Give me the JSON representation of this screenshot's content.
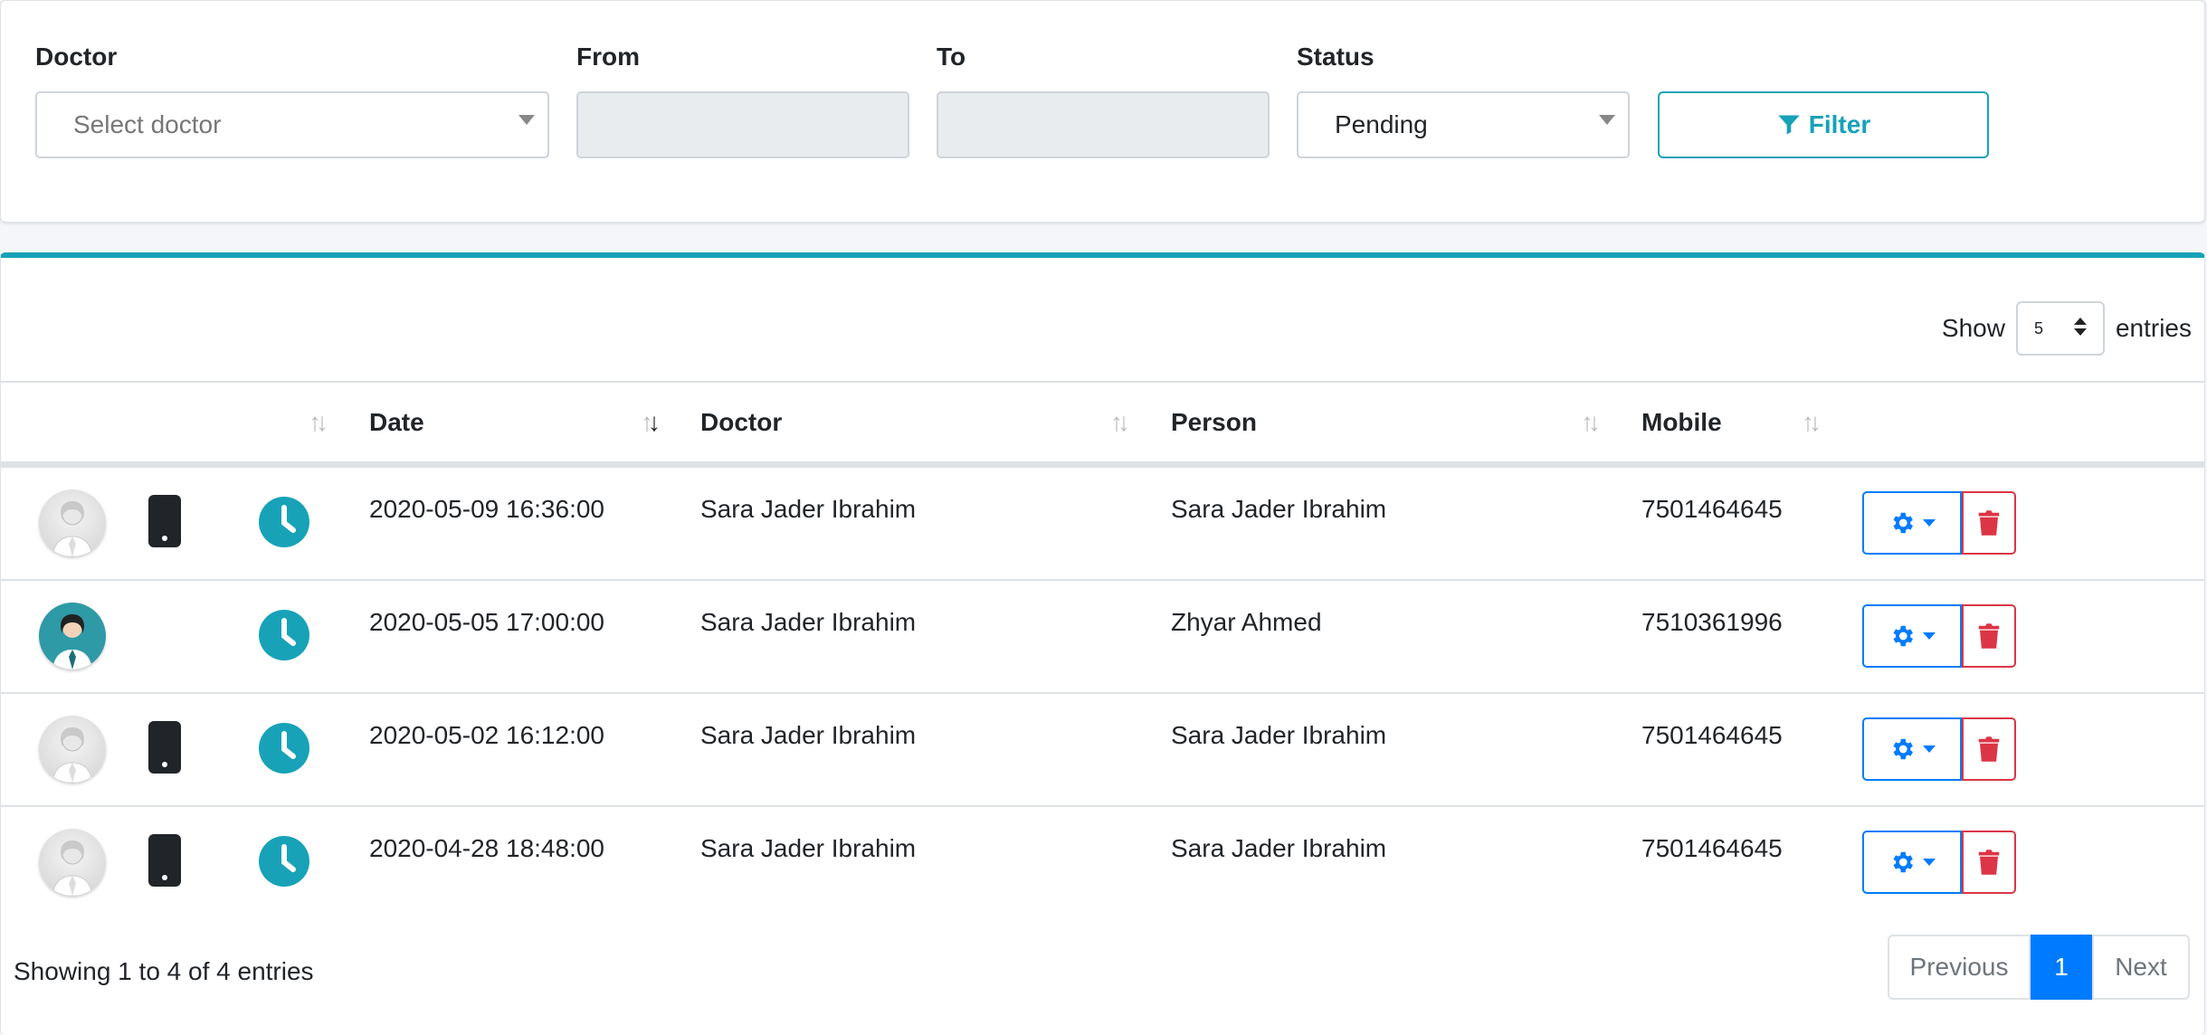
{
  "filters": {
    "doctor_label": "Doctor",
    "doctor_placeholder": "Select doctor",
    "from_label": "From",
    "to_label": "To",
    "status_label": "Status",
    "status_value": "Pending",
    "filter_button": "Filter"
  },
  "table": {
    "show_label": "Show",
    "entries_label": "entries",
    "page_length": "5",
    "headers": {
      "date": "Date",
      "doctor": "Doctor",
      "person": "Person",
      "mobile": "Mobile"
    },
    "rows": [
      {
        "avatar": "doctor-avatar-gray",
        "has_phone": true,
        "date": "2020-05-09 16:36:00",
        "doctor": "Sara Jader Ibrahim",
        "person": "Sara Jader Ibrahim",
        "mobile": "7501464645"
      },
      {
        "avatar": "doctor-avatar-teal",
        "has_phone": false,
        "date": "2020-05-05 17:00:00",
        "doctor": "Sara Jader Ibrahim",
        "person": "Zhyar Ahmed",
        "mobile": "7510361996"
      },
      {
        "avatar": "doctor-avatar-gray",
        "has_phone": true,
        "date": "2020-05-02 16:12:00",
        "doctor": "Sara Jader Ibrahim",
        "person": "Sara Jader Ibrahim",
        "mobile": "7501464645"
      },
      {
        "avatar": "doctor-avatar-gray",
        "has_phone": true,
        "date": "2020-04-28 18:48:00",
        "doctor": "Sara Jader Ibrahim",
        "person": "Sara Jader Ibrahim",
        "mobile": "7501464645"
      }
    ],
    "info": "Showing 1 to 4 of 4 entries"
  },
  "pagination": {
    "previous": "Previous",
    "current": "1",
    "next": "Next"
  },
  "colors": {
    "accent": "#17a2b8",
    "primary": "#007bff",
    "danger": "#dc3545"
  },
  "icons": [
    "filter-icon",
    "phone-icon",
    "clock-icon",
    "gear-icon",
    "trash-icon",
    "sort-icon"
  ]
}
